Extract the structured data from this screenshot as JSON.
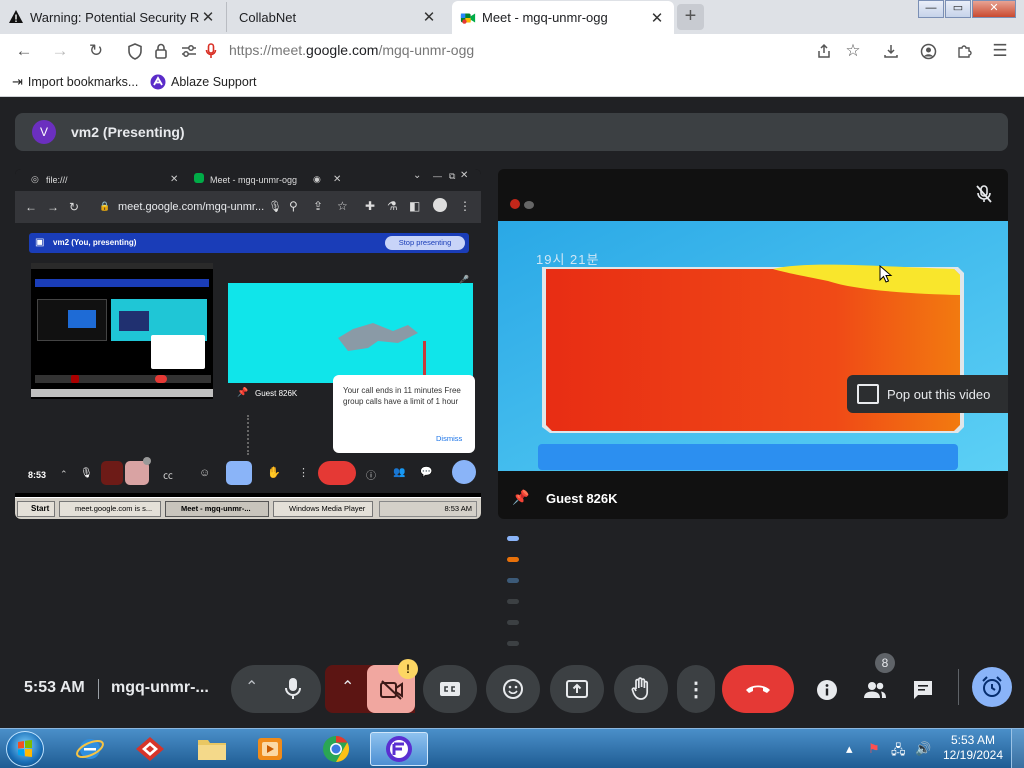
{
  "tabs": [
    {
      "title": "Warning: Potential Security Risk",
      "icon": "warning-icon"
    },
    {
      "title": "CollabNet",
      "icon": "none"
    },
    {
      "title": "Meet - mgq-unmr-ogg",
      "icon": "meet-icon",
      "active": true
    }
  ],
  "address": {
    "prefix": "https://meet.",
    "domain": "google.com",
    "path": "/mgq-unmr-ogg"
  },
  "bookmarks": [
    {
      "label": "Import bookmarks...",
      "icon": "import-icon"
    },
    {
      "label": "Ablaze Support",
      "icon": "ablaze-icon"
    }
  ],
  "presenting": {
    "avatar_letter": "V",
    "title": "vm2 (Presenting)"
  },
  "guest_tile": {
    "name": "Guest 826K",
    "popout_label": "Pop out this video"
  },
  "shared_screen": {
    "tab1": "file:///",
    "tab2": "Meet - mgq-unmr-ogg",
    "url": "meet.google.com/mgq-unmr...",
    "banner": "vm2 (You, presenting)",
    "stop_label": "Stop presenting",
    "inner_guest": "Guest 826K",
    "notice_text": "Your call ends in 11 minutes Free group calls have a limit of 1 hour",
    "dismiss_label": "Dismiss",
    "inner_clock": "8:53",
    "taskbar_items": [
      "Start",
      "meet.google.com is s...",
      "Meet - mgq-unmr-...",
      "Windows Media Player"
    ],
    "taskbar_time": "8:53 AM"
  },
  "video_overlay": {
    "top_left_text": "19시 21분"
  },
  "controls": {
    "time": "5:53 AM",
    "meeting_code": "mgq-unmr-...",
    "people_count": "8",
    "camera_alert": "!"
  },
  "taskbar": {
    "time": "5:53 AM",
    "date": "12/19/2024"
  },
  "colors": {
    "end_call": "#e53935",
    "accent": "#8ab4f8",
    "page_bg": "#202124"
  }
}
